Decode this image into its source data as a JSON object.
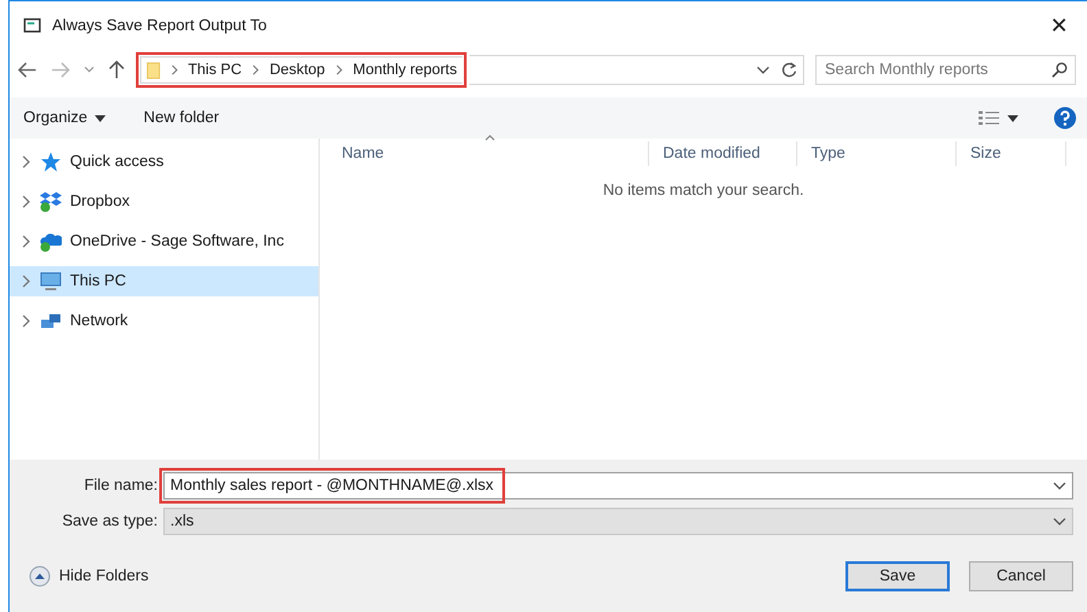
{
  "window": {
    "title": "Always Save Report Output To",
    "close": "✕"
  },
  "address": {
    "crumbs": [
      "This PC",
      "Desktop",
      "Monthly reports"
    ]
  },
  "search": {
    "placeholder": "Search Monthly reports"
  },
  "toolbar": {
    "organize": "Organize",
    "new_folder": "New folder"
  },
  "sidebar": {
    "items": [
      {
        "label": "Quick access",
        "selected": false
      },
      {
        "label": "Dropbox",
        "selected": false
      },
      {
        "label": "OneDrive - Sage Software, Inc",
        "selected": false
      },
      {
        "label": "This PC",
        "selected": true
      },
      {
        "label": "Network",
        "selected": false
      }
    ]
  },
  "table": {
    "columns": [
      "Name",
      "Date modified",
      "Type",
      "Size"
    ],
    "empty_message": "No items match your search."
  },
  "file_name": {
    "label": "File name:",
    "value": "Monthly sales report - @MONTHNAME@.xlsx"
  },
  "save_as_type": {
    "label": "Save as type:",
    "value": ".xls"
  },
  "hide_folders": "Hide Folders",
  "buttons": [
    "Save",
    "Cancel"
  ]
}
